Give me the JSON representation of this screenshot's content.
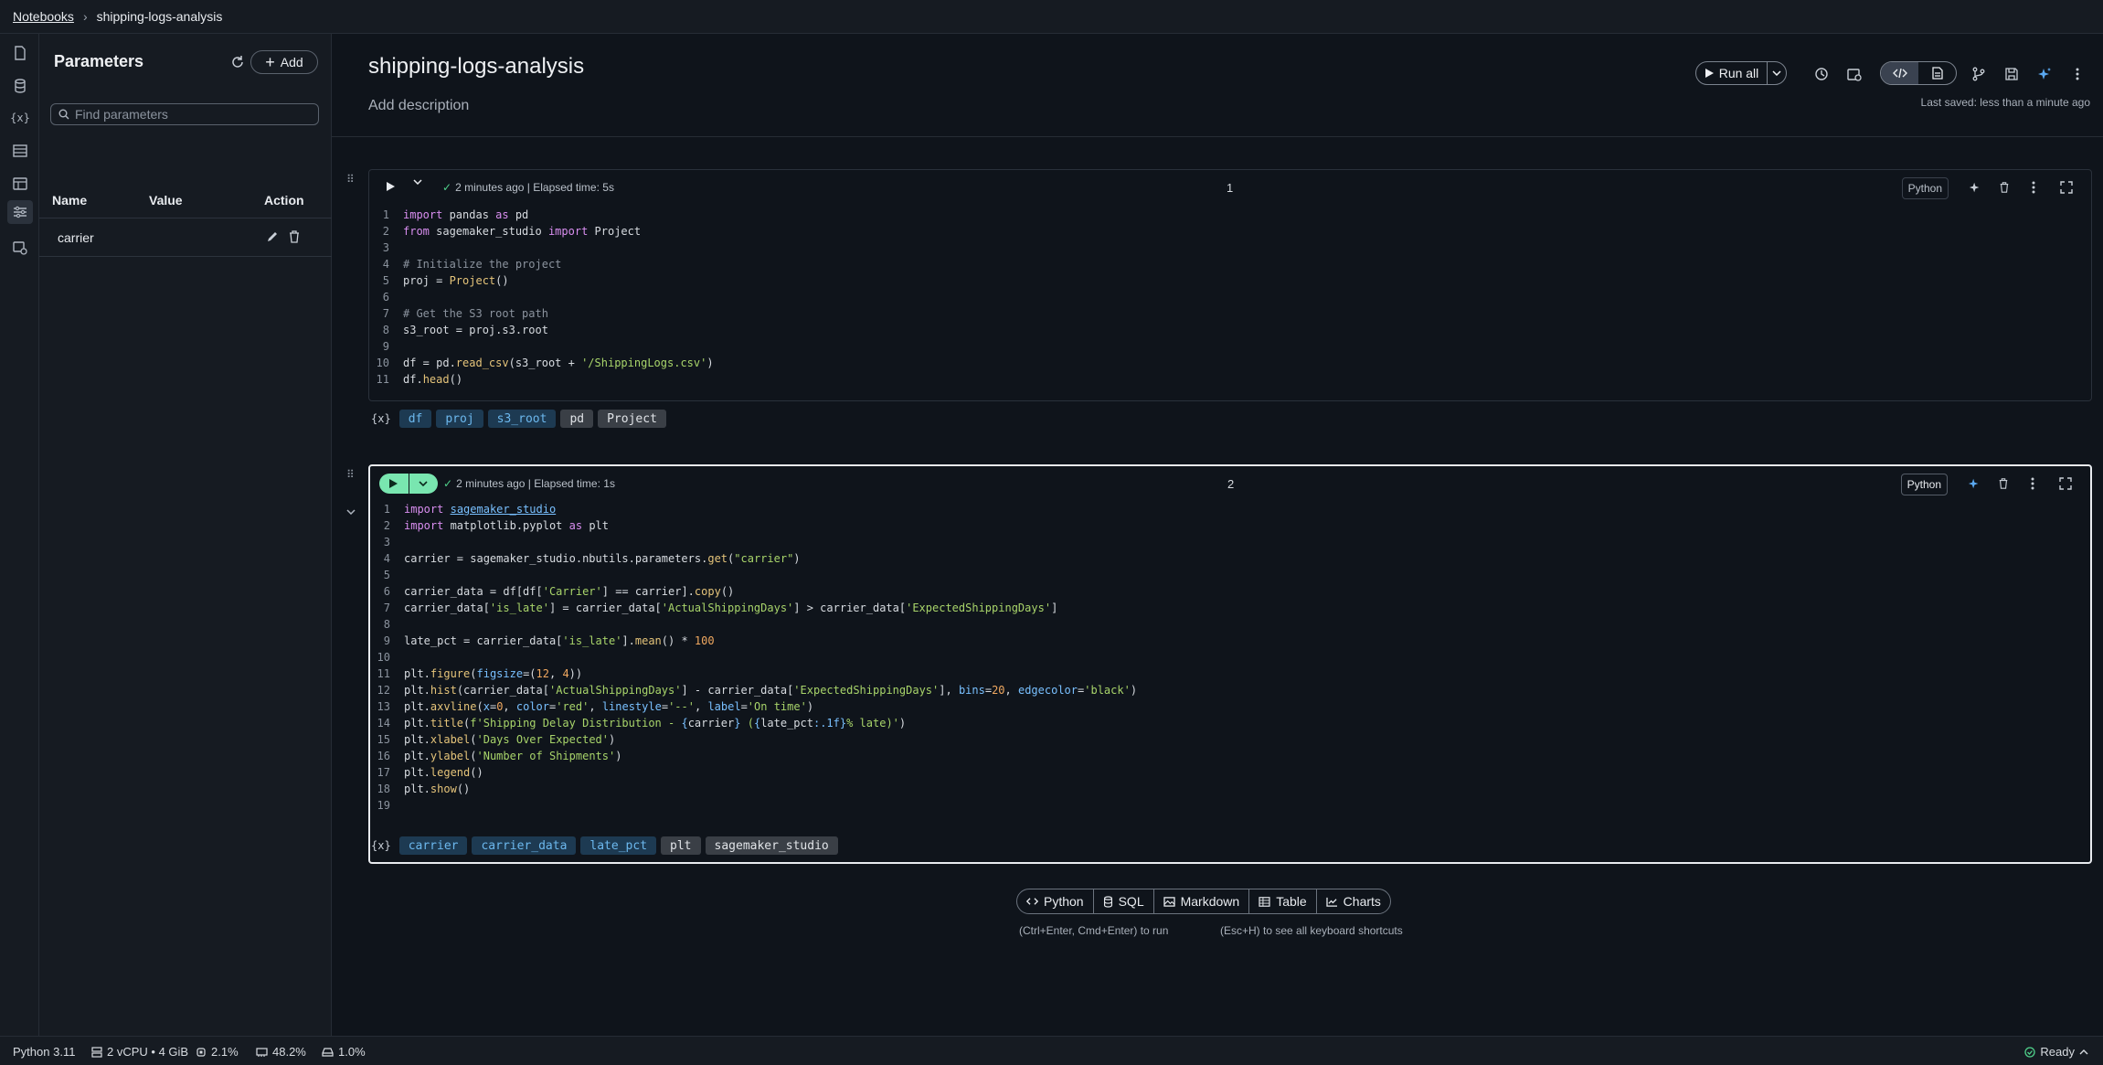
{
  "breadcrumb": {
    "root": "Notebooks",
    "separator": "›",
    "current": "shipping-logs-analysis"
  },
  "params_panel": {
    "title": "Parameters",
    "add_label": "Add",
    "search_placeholder": "Find parameters",
    "columns": {
      "name": "Name",
      "value": "Value",
      "action": "Action"
    },
    "rows": [
      {
        "name": "carrier",
        "value": ""
      }
    ]
  },
  "notebook": {
    "title": "shipping-logs-analysis",
    "description_placeholder": "Add description",
    "run_all_label": "Run all",
    "last_saved": "Last saved: less than a minute ago"
  },
  "cells": [
    {
      "number": "1",
      "status": "2 minutes ago | Elapsed time: 5s",
      "language": "Python",
      "line_numbers": [
        "1",
        "2",
        "3",
        "4",
        "5",
        "6",
        "7",
        "8",
        "9",
        "10",
        "11"
      ],
      "variables": [
        "df",
        "proj",
        "s3_root",
        "pd",
        "Project"
      ]
    },
    {
      "number": "2",
      "status": "2 minutes ago | Elapsed time: 1s",
      "language": "Python",
      "line_numbers": [
        "1",
        "2",
        "3",
        "4",
        "5",
        "6",
        "7",
        "8",
        "9",
        "10",
        "11",
        "12",
        "13",
        "14",
        "15",
        "16",
        "17",
        "18",
        "19"
      ],
      "variables": [
        "carrier",
        "carrier_data",
        "late_pct",
        "plt",
        "sagemaker_studio"
      ]
    }
  ],
  "variables_marker": "{x}",
  "add_cell": {
    "python": "Python",
    "sql": "SQL",
    "markdown": "Markdown",
    "table": "Table",
    "charts": "Charts"
  },
  "hints": {
    "run": "(Ctrl+Enter, Cmd+Enter) to run",
    "shortcuts": "(Esc+H) to see all keyboard shortcuts"
  },
  "status_bar": {
    "kernel": "Python 3.11",
    "compute": "2 vCPU • 4 GiB",
    "cpu": "2.1%",
    "memory": "48.2%",
    "disk": "1.0%",
    "state": "Ready"
  },
  "colors": {
    "background": "#0f141b",
    "panel": "#161b22",
    "run_green": "#79e6b0",
    "chip_blue": "#1d3a52",
    "accent_blue": "#6cb8ee"
  }
}
